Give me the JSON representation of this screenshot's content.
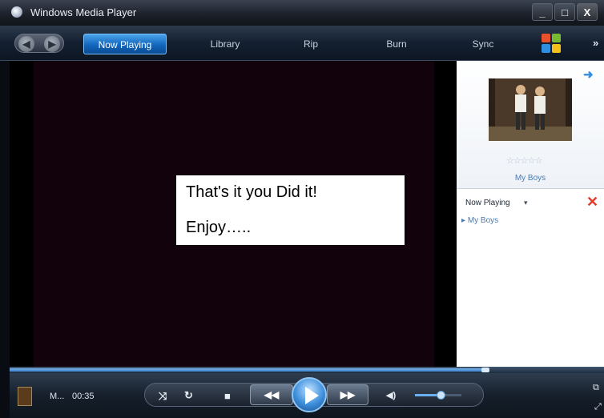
{
  "window": {
    "title": "Windows Media Player",
    "minimize_label": "_",
    "maximize_label": "□",
    "close_label": "X"
  },
  "nav": {
    "tabs": [
      {
        "label": "Now Playing",
        "active": true
      },
      {
        "label": "Library",
        "active": false
      },
      {
        "label": "Rip",
        "active": false
      },
      {
        "label": "Burn",
        "active": false
      },
      {
        "label": "Sync",
        "active": false
      }
    ],
    "more_label": "»",
    "back_icon": "back-arrow-icon",
    "forward_icon": "forward-arrow-icon"
  },
  "video": {
    "caption_line1": "That's it you Did it!",
    "caption_line2": "Enjoy….."
  },
  "pane": {
    "rating_stars": "☆☆☆☆☆",
    "album_title": "My Boys",
    "now_playing_label": "Now Playing",
    "now_playing_caret": "▾",
    "close_symbol": "✕",
    "playlist": [
      {
        "label": "My Boys"
      }
    ]
  },
  "controls": {
    "now_title": "M...",
    "time": "00:35",
    "seek_progress": 0.8,
    "volume_level": 0.55,
    "shuffle_symbol": "⤨",
    "repeat_symbol": "↻",
    "stop_symbol": "■",
    "prev_symbol": "◀◀",
    "next_symbol": "▶▶",
    "mute_symbol": "◀)",
    "switch_symbol": "⧉",
    "fullscreen_symbol": "⤢"
  },
  "colors": {
    "accent": "#1266bd",
    "remove_red": "#e23b2b",
    "link_blue": "#4b79b0"
  }
}
